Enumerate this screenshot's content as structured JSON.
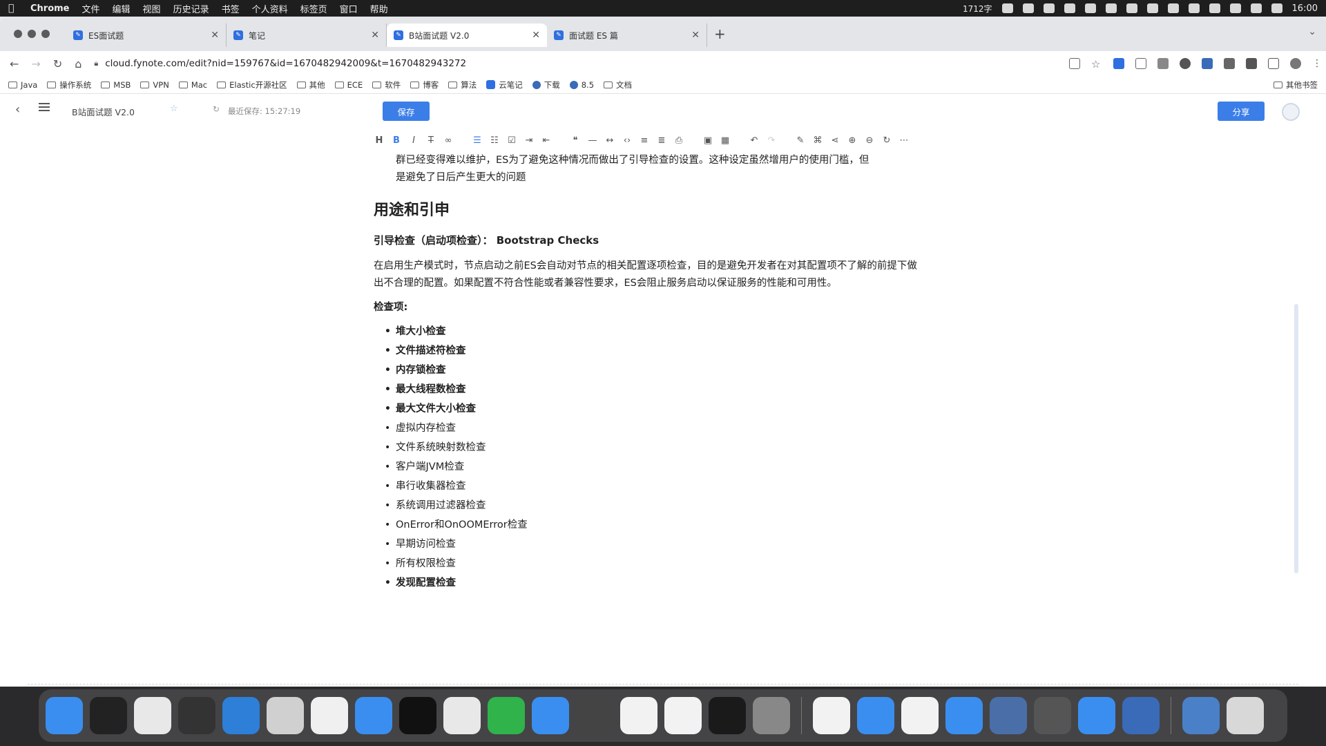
{
  "menubar": {
    "app": "Chrome",
    "items": [
      "文件",
      "编辑",
      "视图",
      "历史记录",
      "书签",
      "个人资料",
      "标签页",
      "窗口",
      "帮助"
    ],
    "word_count": "1712字",
    "clock": "16:00"
  },
  "tabs": [
    {
      "title": "ES面试题"
    },
    {
      "title": "笔记"
    },
    {
      "title": "B站面试题 V2.0"
    },
    {
      "title": "面试题 ES 篇"
    }
  ],
  "address": "cloud.fynote.com/edit?nid=159767&id=1670482942009&t=1670482943272",
  "bookmarks": [
    "Java",
    "操作系统",
    "MSB",
    "VPN",
    "Mac",
    "Elastic开源社区",
    "其他",
    "ECE",
    "软件",
    "博客",
    "算法",
    "云笔记",
    "下载",
    "8.5",
    "文档"
  ],
  "bookmarks_other": "其他书签",
  "app": {
    "doc_title": "B站面试题 V2.0",
    "saved_time": "最近保存: 15:27:19",
    "save_label": "保存",
    "share_label": "分享"
  },
  "content": {
    "prev_text_1": "群已经变得难以维护，ES为了避免这种情况而做出了引导检查的设置。这种设定虽然增用户的使用门槛，但",
    "prev_text_2": "是避免了日后产生更大的问题",
    "heading": "用途和引申",
    "subheading": "引导检查（启动项检查）： Bootstrap Checks",
    "paragraph": "在启用生产模式时，节点启动之前ES会自动对节点的相关配置逐项检查，目的是避免开发者在对其配置项不了解的前提下做出不合理的配置。如果配置不符合性能或者兼容性要求，ES会阻止服务启动以保证服务的性能和可用性。",
    "checks_label": "检查项:",
    "checks": [
      {
        "text": "堆大小检查",
        "bold": true
      },
      {
        "text": "文件描述符检查",
        "bold": true
      },
      {
        "text": "内存锁检查",
        "bold": true
      },
      {
        "text": "最大线程数检查",
        "bold": true
      },
      {
        "text": "最大文件大小检查",
        "bold": true
      },
      {
        "text": "虚拟内存检查",
        "bold": false
      },
      {
        "text": "文件系统映射数检查",
        "bold": false
      },
      {
        "text": "客户端JVM检查",
        "bold": false
      },
      {
        "text": "串行收集器检查",
        "bold": false
      },
      {
        "text": "系统调用过滤器检查",
        "bold": false
      },
      {
        "text": "OnError和OnOOMError检查",
        "bold": false
      },
      {
        "text": "早期访问检查",
        "bold": false
      },
      {
        "text": "所有权限检查",
        "bold": false
      },
      {
        "text": "发现配置检查",
        "bold": true
      }
    ]
  },
  "editor_tools": [
    "H",
    "B",
    "I",
    "S",
    "link",
    "ul",
    "ol",
    "check",
    "indent",
    "outdent",
    "quote",
    "hr",
    "code",
    "inline-code",
    "align",
    "align2",
    "clip",
    "image",
    "table",
    "undo",
    "redo",
    "pen",
    "tag",
    "share",
    "zoom-in",
    "zoom-out",
    "refresh",
    "more"
  ],
  "dock": [
    {
      "name": "finder",
      "color": "#3a8ef0"
    },
    {
      "name": "terminal",
      "color": "#222222"
    },
    {
      "name": "app3",
      "color": "#e8e8e8"
    },
    {
      "name": "app4",
      "color": "#333333"
    },
    {
      "name": "edge",
      "color": "#2d7fd8"
    },
    {
      "name": "app6",
      "color": "#d0d0d0"
    },
    {
      "name": "app7",
      "color": "#f0f0f0"
    },
    {
      "name": "app8",
      "color": "#3a8ef0"
    },
    {
      "name": "qq",
      "color": "#111111"
    },
    {
      "name": "app10",
      "color": "#e8e8e8"
    },
    {
      "name": "wechat",
      "color": "#2fb34a"
    },
    {
      "name": "app12",
      "color": "#3a8ef0"
    },
    {
      "name": "app13",
      "color": "#444444"
    },
    {
      "name": "app14",
      "color": "#f2f2f2"
    },
    {
      "name": "typora",
      "color": "#f2f2f2"
    },
    {
      "name": "app16",
      "color": "#1a1a1a"
    },
    {
      "name": "settings",
      "color": "#888888"
    },
    {
      "name": "wps",
      "color": "#f2f2f2"
    },
    {
      "name": "app19",
      "color": "#3a8ef0"
    },
    {
      "name": "app20",
      "color": "#f2f2f2"
    },
    {
      "name": "app21",
      "color": "#3a8ef0"
    },
    {
      "name": "app22",
      "color": "#4a6fa8"
    },
    {
      "name": "app23",
      "color": "#555555"
    },
    {
      "name": "app24",
      "color": "#3a8ef0"
    },
    {
      "name": "app25",
      "color": "#3a6bb8"
    },
    {
      "name": "downloads",
      "color": "#4a80c8"
    },
    {
      "name": "trash",
      "color": "#d8d8d8"
    }
  ]
}
